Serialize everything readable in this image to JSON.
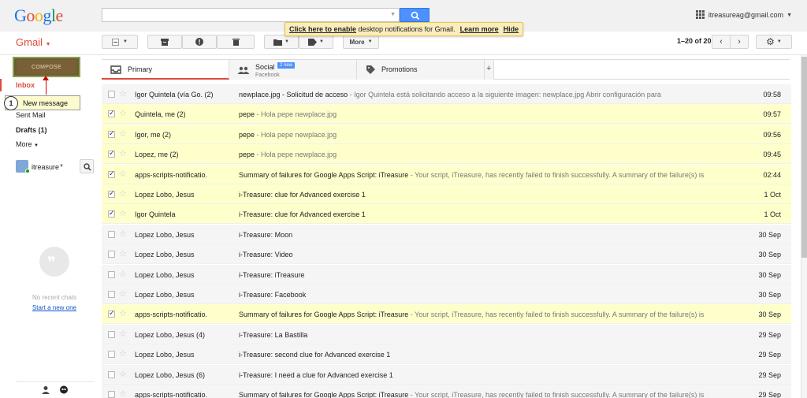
{
  "header": {
    "logo_letters": [
      "G",
      "o",
      "o",
      "g",
      "l",
      "e"
    ],
    "logo_colors": [
      "#1a73e8",
      "#dd4b39",
      "#f4b400",
      "#1a73e8",
      "#0f9d58",
      "#dd4b39"
    ],
    "account_email": "itreasureag@gmail.com",
    "search_placeholder": ""
  },
  "notification": {
    "link_text": "Click here to enable",
    "rest_text": " desktop notifications for Gmail.",
    "learn_more": "Learn more",
    "hide": "Hide"
  },
  "toolbar": {
    "app_label": "Gmail",
    "more_label": "More",
    "pager_text": "1–20 of 20",
    "accent_color": "#dd4b39"
  },
  "sidebar": {
    "compose_label": "COMPOSE",
    "items": [
      {
        "label": "Inbox"
      },
      {
        "label": "Sent Mail"
      },
      {
        "label": "Drafts (1)"
      },
      {
        "label": "More"
      }
    ],
    "callout_number": "1",
    "callout_text": "New message",
    "chat_user": "itreasure",
    "no_chats": "No recent chats",
    "start_new": "Start a new one"
  },
  "tabs": [
    {
      "label": "Primary",
      "sub": "",
      "badge": "",
      "icon": "inbox-icon"
    },
    {
      "label": "Social",
      "sub": "Facebook",
      "badge": "2 new",
      "icon": "people-icon"
    },
    {
      "label": "Promotions",
      "sub": "",
      "badge": "",
      "icon": "tag-icon"
    }
  ],
  "emails": [
    {
      "sender": "Igor Quintela (vía Go. (2)",
      "subject": "newplace.jpg - Solicitud de acceso",
      "snippet": " - Igor Quintela está solicitando acceso a la siguiente imagen: newplace.jpg Abrir configuración para",
      "date": "09:58",
      "checked": false
    },
    {
      "sender": "Quintela, me (2)",
      "subject": "pepe",
      "snippet": " - Hola pepe newplace.jpg",
      "date": "09:57",
      "checked": true
    },
    {
      "sender": "Igor, me (2)",
      "subject": "pepe",
      "snippet": " - Hola pepe newplace.jpg",
      "date": "09:56",
      "checked": true
    },
    {
      "sender": "Lopez, me (2)",
      "subject": "pepe",
      "snippet": " - Hola pepe newplace.jpg",
      "date": "09:45",
      "checked": true
    },
    {
      "sender": "apps-scripts-notificatio.",
      "subject": "Summary of failures for Google Apps Script: iTreasure",
      "snippet": " - Your script, iTreasure, has recently failed to finish successfully. A summary of the failure(s) is",
      "date": "02:44",
      "checked": true
    },
    {
      "sender": "Lopez Lobo, Jesus",
      "subject": "i-Treasure: clue for Advanced exercise 1",
      "snippet": "",
      "date": "1 Oct",
      "checked": true
    },
    {
      "sender": "Igor Quintela",
      "subject": "i-Treasure: clue for Advanced exercise 1",
      "snippet": "",
      "date": "1 Oct",
      "checked": true
    },
    {
      "sender": "Lopez Lobo, Jesus",
      "subject": "i-Treasure: Moon",
      "snippet": "",
      "date": "30 Sep",
      "checked": false
    },
    {
      "sender": "Lopez Lobo, Jesus",
      "subject": "i-Treasure: Video",
      "snippet": "",
      "date": "30 Sep",
      "checked": false
    },
    {
      "sender": "Lopez Lobo, Jesus",
      "subject": "i-Treasure: iTreasure",
      "snippet": "",
      "date": "30 Sep",
      "checked": false
    },
    {
      "sender": "Lopez Lobo, Jesus",
      "subject": "i-Treasure: Facebook",
      "snippet": "",
      "date": "30 Sep",
      "checked": false
    },
    {
      "sender": "apps-scripts-notificatio.",
      "subject": "Summary of failures for Google Apps Script: iTreasure",
      "snippet": " - Your script, iTreasure, has recently failed to finish successfully. A summary of the failure(s) is",
      "date": "30 Sep",
      "checked": true
    },
    {
      "sender": "Lopez Lobo, Jesus (4)",
      "subject": "i-Treasure: La Bastilla",
      "snippet": "",
      "date": "29 Sep",
      "checked": false
    },
    {
      "sender": "Lopez Lobo, Jesus",
      "subject": "i-Treasure: second clue for Advanced exercise 1",
      "snippet": "",
      "date": "29 Sep",
      "checked": false
    },
    {
      "sender": "Lopez Lobo, Jesus (6)",
      "subject": "i-Treasure: I need a clue for Advanced exercise 1",
      "snippet": "",
      "date": "29 Sep",
      "checked": false
    },
    {
      "sender": "apps-scripts-notificatio.",
      "subject": "Summary of failures for Google Apps Script: iTreasure",
      "snippet": " - Your script, iTreasure, has recently failed to finish successfully. A summary of the failure(s) is",
      "date": "29 Sep",
      "checked": false
    }
  ]
}
